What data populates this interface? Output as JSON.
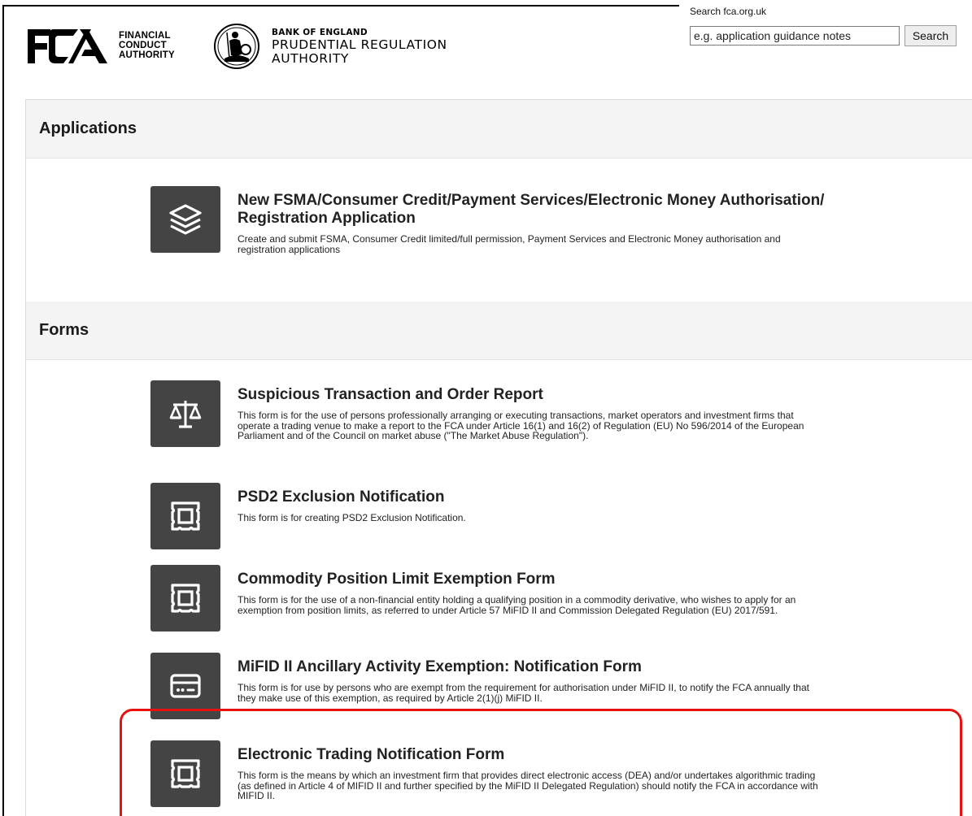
{
  "header": {
    "fca_words": [
      "FINANCIAL",
      "CONDUCT",
      "AUTHORITY"
    ],
    "boe_line1": "BANK OF ENGLAND",
    "boe_line2": "PRUDENTIAL REGULATION",
    "boe_line3": "AUTHORITY"
  },
  "search": {
    "label": "Search fca.org.uk",
    "placeholder": "e.g. application guidance notes",
    "button_label": "Search"
  },
  "sections": {
    "applications": {
      "title": "Applications",
      "items": [
        {
          "icon": "layers-icon",
          "title_line1": "New FSMA/Consumer Credit/Payment Services/Electronic Money Authorisation/",
          "title_line2": "Registration Application",
          "desc_line1": "Create and submit FSMA, Consumer Credit limited/full permission, Payment Services and Electronic Money authorisation and",
          "desc_line2": "registration applications"
        }
      ]
    },
    "forms": {
      "title": "Forms",
      "items": [
        {
          "icon": "scales-icon",
          "title": "Suspicious Transaction and Order Report",
          "desc_line1": "This form is for the use of persons professionally arranging or executing transactions, market operators and investment firms that",
          "desc_line2": "operate a trading venue to make a report to the FCA under Article 16(1) and 16(2) of Regulation (EU) No 596/2014 of the European",
          "desc_line3": "Parliament and of the Council on market abuse (\"The Market Abuse Regulation\")."
        },
        {
          "icon": "stamp-icon",
          "title": "PSD2 Exclusion Notification",
          "desc_line1": "This form is for creating PSD2 Exclusion Notification."
        },
        {
          "icon": "stamp-icon",
          "title": "Commodity Position Limit Exemption Form",
          "desc_line1": "This form is for the use of a non-financial entity holding a qualifying position in a commodity derivative, who wishes to apply for an",
          "desc_line2": "exemption from position limits, as referred to under Article 57 MiFID II and Commission Delegated Regulation (EU) 2017/591."
        },
        {
          "icon": "card-icon",
          "title": "MiFID II Ancillary Activity Exemption: Notification Form",
          "desc_line1": "This form is for use by persons who are exempt from the requirement for authorisation under MiFID II, to notify the FCA annually that",
          "desc_line2": "they make use of this exemption, as required by Article 2(1)(j) MiFID II."
        },
        {
          "icon": "stamp-icon",
          "title": "Electronic Trading Notification Form",
          "desc_line1": "This form is the means by which an investment firm that provides direct electronic access (DEA) and/or undertakes algorithmic trading",
          "desc_line2": "(as defined in Article 4 of MIFID II and further specified by the MiFID II Delegated Regulation) should notify the FCA in accordance with",
          "desc_line3": "MIFID II."
        }
      ]
    }
  },
  "colors": {
    "icon_bg": "#444444",
    "section_bg": "#f4f4f4",
    "highlight": "#e81010"
  }
}
